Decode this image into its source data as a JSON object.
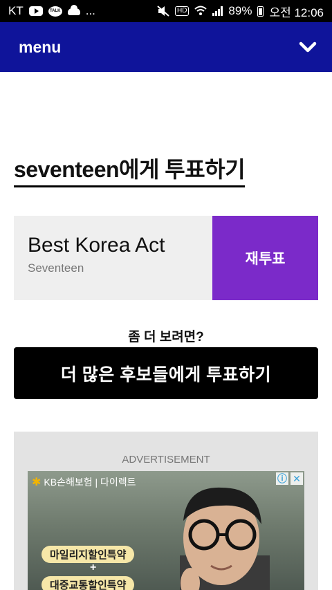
{
  "status": {
    "carrier": "KT",
    "more": "...",
    "battery": "89%",
    "time": "오전 12:06"
  },
  "nav": {
    "menu_label": "menu"
  },
  "page": {
    "title": "seventeen에게 투표하기"
  },
  "vote": {
    "award": "Best Korea Act",
    "nominee": "Seventeen",
    "revote_label": "재투표"
  },
  "more": {
    "question": "좀 더 보려면?",
    "button_label": "더 많은 후보들에게 투표하기"
  },
  "ad": {
    "label": "ADVERTISEMENT",
    "brand": "KB손해보험 | 다이렉트",
    "tag1": "마일리지할인특약",
    "plus": "+",
    "tag2": "대중교통할인특약"
  },
  "colors": {
    "nav_bg": "#0f149a",
    "revote_bg": "#7b2ac9",
    "more_button_bg": "#000000"
  }
}
